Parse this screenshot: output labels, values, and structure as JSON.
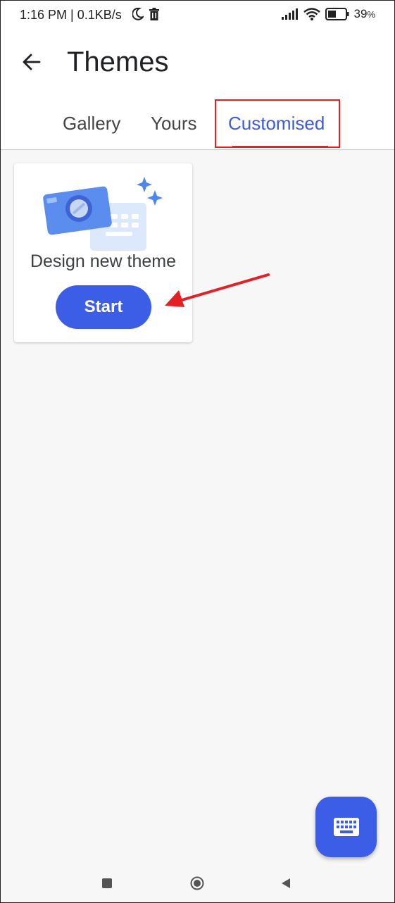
{
  "status_bar": {
    "time": "1:16 PM",
    "speed": "0.1KB/s",
    "battery_percent": "39",
    "battery_suffix": "%",
    "icons": [
      "moon-icon",
      "trash-icon",
      "signal-icon",
      "wifi-icon",
      "battery-icon"
    ]
  },
  "app_bar": {
    "title": "Themes",
    "back_icon": "arrow-left-icon"
  },
  "tabs": [
    {
      "label": "Gallery",
      "active": false
    },
    {
      "label": "Yours",
      "active": false
    },
    {
      "label": "Customised",
      "active": true
    }
  ],
  "card": {
    "text": "Design new theme",
    "button_label": "Start",
    "illustration": "camera-keyboard-illustration"
  },
  "fab": {
    "icon": "keyboard-icon"
  },
  "nav_bar": {
    "icons": [
      "recents-square-icon",
      "home-circle-icon",
      "back-triangle-icon"
    ]
  },
  "colors": {
    "accent": "#3c5ee6",
    "tab_active": "#3b5bdb",
    "annotation_red": "#e32025",
    "background": "#f7f7f7"
  }
}
